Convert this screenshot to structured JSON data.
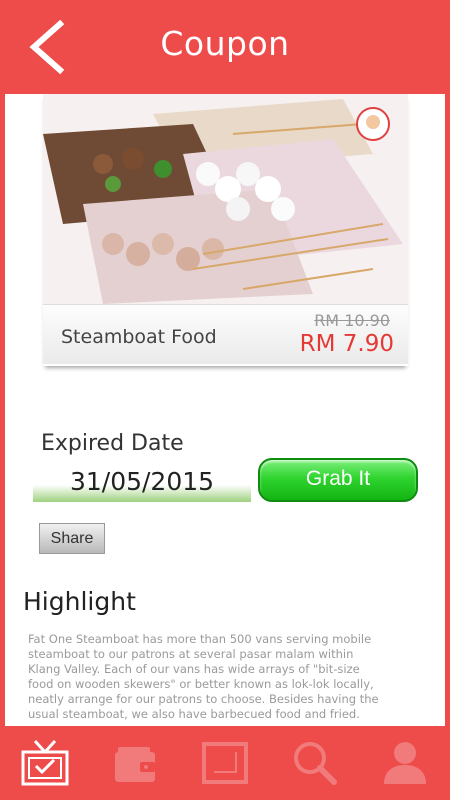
{
  "header": {
    "title": "Coupon"
  },
  "product": {
    "name": "Steamboat Food",
    "old_price": "RM 10.90",
    "new_price": "RM 7.90"
  },
  "coupon": {
    "expired_label": "Expired Date",
    "expired_date": "31/05/2015",
    "grab_label": "Grab It",
    "share_label": "Share"
  },
  "highlight": {
    "title": "Highlight",
    "text": "Fat One Steamboat has more than 500 vans serving mobile steamboat to our patrons at several pasar malam within Klang Valley. Each of our vans has wide arrays of \"bit-size food on wooden skewers\" or better known as lok-lok locally, neatly arrange for our patrons to choose. Besides having the usual steamboat, we also have barbecued food and fried."
  },
  "nav": {
    "items": [
      {
        "icon": "tv-icon"
      },
      {
        "icon": "wallet-icon"
      },
      {
        "icon": "frame-icon"
      },
      {
        "icon": "search-icon"
      },
      {
        "icon": "user-icon"
      }
    ]
  },
  "colors": {
    "brand": "#ee4b4b",
    "price": "#e53935",
    "grab_button": "#2fd42f"
  }
}
